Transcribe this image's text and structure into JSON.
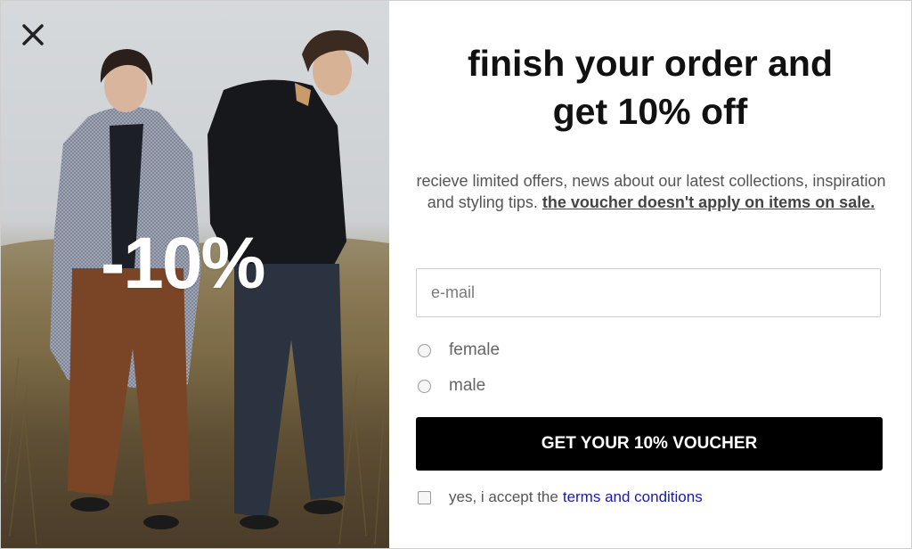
{
  "promo": {
    "discount_overlay": "-10%",
    "close_icon": "close-icon"
  },
  "form": {
    "title_line1": "finish your order and",
    "title_line2": "get 10% off",
    "description": "recieve limited offers, news about our latest collections, inspiration and styling tips.",
    "description_bold": "the voucher doesn't apply on items on sale.",
    "email_placeholder": "e-mail",
    "gender_options": [
      "female",
      "male"
    ],
    "cta_label": "GET YOUR 10% VOUCHER",
    "terms_prefix": "yes, i accept the",
    "terms_link": "terms and conditions"
  },
  "colors": {
    "cta_background": "#000000",
    "link": "#1a1aa6",
    "text_muted": "#555555"
  }
}
